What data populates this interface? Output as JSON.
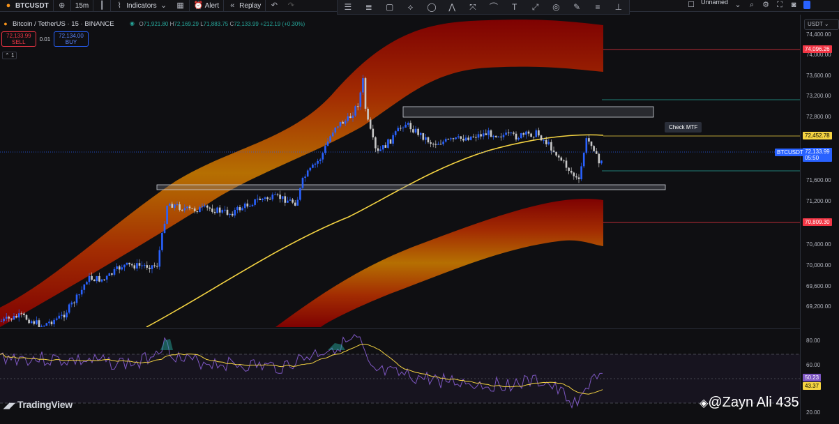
{
  "toolbar": {
    "symbol": "BTCUSDT",
    "interval": "15m",
    "indicators_label": "Indicators",
    "alert_label": "Alert",
    "replay_label": "Replay",
    "layout_name": "Unnamed"
  },
  "legend": {
    "title": "Bitcoin / TetherUS · 15 · BINANCE",
    "open": "71,921.80",
    "high": "72,169.29",
    "low": "71,883.75",
    "close": "72,133.99",
    "change": "+212.19 (+0.30%)"
  },
  "trade": {
    "sell_price": "72,133.99",
    "sell_label": "SELL",
    "spread": "0.01",
    "buy_price": "72,134.00",
    "buy_label": "BUY"
  },
  "collapse_label": "1",
  "currency": "USDT",
  "annotation": "Check MTF",
  "price_axis": {
    "ticks": [
      "74,000.00",
      "73,600.00",
      "73,200.00",
      "72,800.00",
      "71,600.00",
      "71,200.00",
      "70,400.00",
      "70,000.00",
      "69,600.00",
      "69,200.00"
    ],
    "ticks_top": "74,400.00",
    "tags": {
      "red_top": "74,096.26",
      "yellow": "72,452.78",
      "symbol": "BTCUSDT",
      "current": "72,133.99",
      "countdown": "05:50",
      "red_bottom": "70,809.30"
    }
  },
  "rsi_axis": {
    "ticks": [
      "80.00",
      "60.00",
      "20.00"
    ],
    "rsi_value": "50.23",
    "ma_value": "43.37"
  },
  "branding": {
    "logo": "TradingView",
    "watermark": "@Zayn Ali 435"
  },
  "colors": {
    "up": "#2962ff",
    "down": "#c8c8c8",
    "ma": "#f5d442",
    "band_outer": "#8b0000",
    "band_inner": "#c8a800",
    "rsi": "#7e57c2",
    "rsi_ma": "#f5d442"
  }
}
